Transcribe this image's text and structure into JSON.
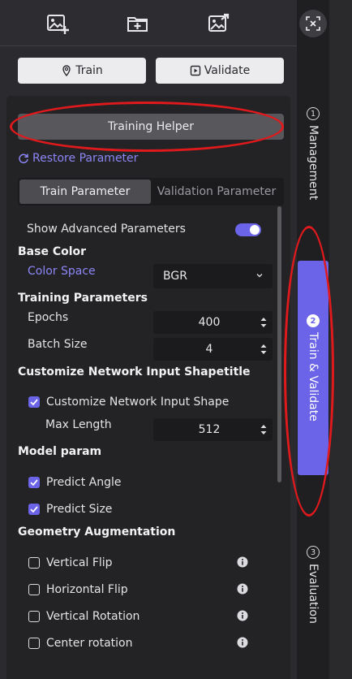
{
  "toolbar": {
    "icons": [
      "add-image-icon",
      "add-folder-icon",
      "export-image-icon"
    ]
  },
  "actions": {
    "train_label": "Train",
    "validate_label": "Validate"
  },
  "helper": {
    "label": "Training Helper"
  },
  "restore": {
    "label": "Restore Parameter"
  },
  "tabs": [
    {
      "label": "Train Parameter",
      "active": true
    },
    {
      "label": "Validation Parameter",
      "active": false
    }
  ],
  "advanced": {
    "label": "Show Advanced Parameters",
    "enabled": true
  },
  "base_color": {
    "title": "Base Color",
    "color_space_label": "Color Space",
    "color_space_value": "BGR"
  },
  "training": {
    "title": "Training Parameters",
    "epochs_label": "Epochs",
    "epochs_value": "400",
    "batch_label": "Batch Size",
    "batch_value": "4"
  },
  "network": {
    "title": "Customize Network Input Shapetitle",
    "checkbox_label": "Customize Network Input Shape",
    "checked": true,
    "max_length_label": "Max Length",
    "max_length_value": "512"
  },
  "model": {
    "title": "Model param",
    "predict_angle_label": "Predict Angle",
    "predict_angle_checked": true,
    "predict_size_label": "Predict Size",
    "predict_size_checked": true
  },
  "geometry": {
    "title": "Geometry Augmentation",
    "items": [
      {
        "label": "Vertical Flip",
        "checked": false
      },
      {
        "label": "Horizontal Flip",
        "checked": false
      },
      {
        "label": "Vertical Rotation",
        "checked": false
      },
      {
        "label": "Center rotation",
        "checked": false
      }
    ]
  },
  "side_tabs": [
    {
      "number": "1",
      "label": "Management",
      "active": false
    },
    {
      "number": "2",
      "label": "Train & Validate",
      "active": true
    },
    {
      "number": "3",
      "label": "Evaluation",
      "active": false
    }
  ],
  "colors": {
    "accent": "#6b64e8",
    "highlight_red": "#e0191c",
    "link": "#8c86f5"
  }
}
